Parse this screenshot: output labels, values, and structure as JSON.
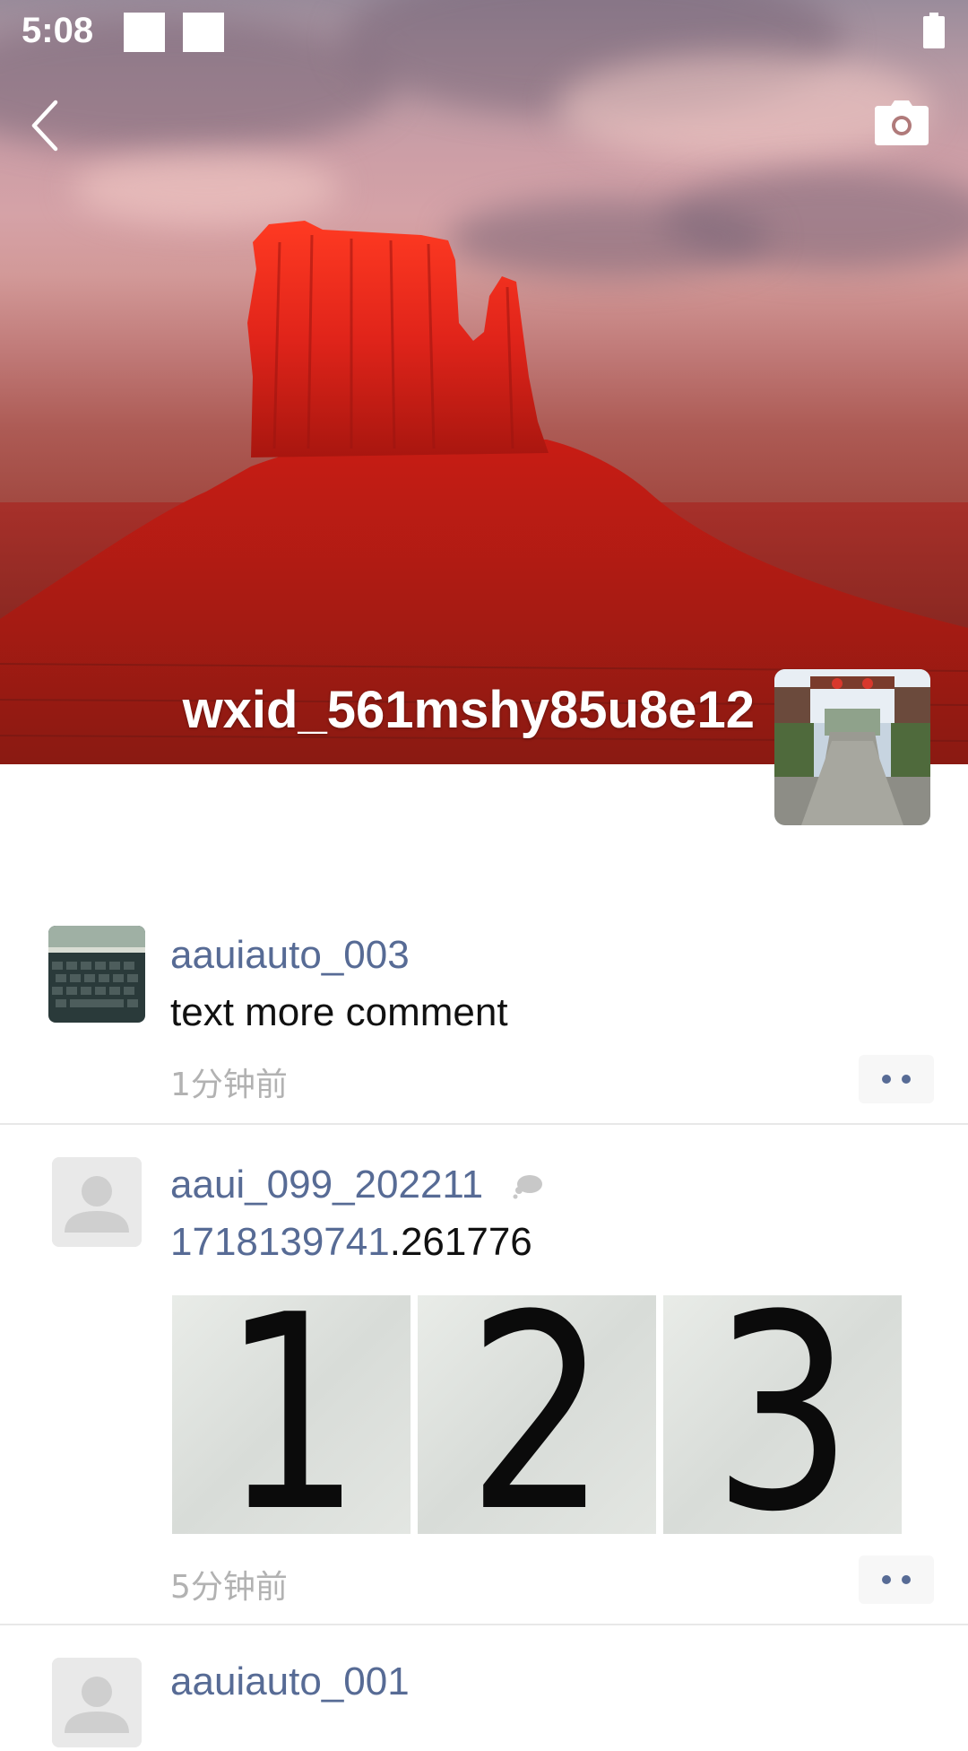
{
  "status_bar": {
    "time": "5:08"
  },
  "header": {
    "back_icon": "chevron-left-icon",
    "camera_icon": "camera-icon",
    "profile_name": "wxid_561mshy85u8e12"
  },
  "feed": {
    "posts": [
      {
        "username": "aauiauto_003",
        "text": "text more comment",
        "time": "1分钟前",
        "avatar": "keyboard-photo"
      },
      {
        "username": "aaui_099_202211",
        "text_link": "1718139741",
        "text_rest": ".261776",
        "images": [
          "1",
          "2",
          "3"
        ],
        "time": "5分钟前",
        "avatar": "default-person-icon",
        "badge_icon": "chat-bubble-icon"
      },
      {
        "username": "aauiauto_001",
        "avatar": "default-person-icon"
      }
    ]
  },
  "colors": {
    "link": "#576b95",
    "timestamp": "#b2b2b2",
    "divider": "#e8e8e8"
  }
}
